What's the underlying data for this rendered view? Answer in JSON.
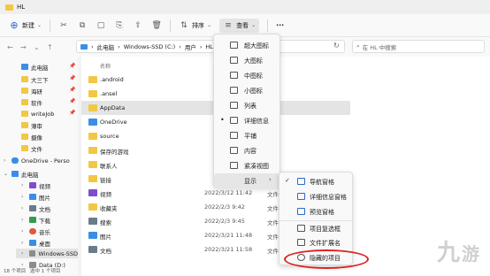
{
  "window": {
    "title": "HL"
  },
  "toolbar": {
    "new_label": "新建",
    "sort_label": "排序",
    "view_label": "查看",
    "more_label": "···"
  },
  "address": {
    "crumbs": [
      "此电脑",
      "Windows-SSD (C:)",
      "用户",
      "HL"
    ],
    "search_placeholder": "在 HL 中搜索"
  },
  "sidebar": {
    "quick": [
      {
        "label": "此电脑",
        "color": "#3a8ee6"
      },
      {
        "label": "大三下",
        "color": "#f2c744"
      },
      {
        "label": "海研",
        "color": "#f2c744"
      },
      {
        "label": "软件",
        "color": "#f2c744"
      },
      {
        "label": "writeJob",
        "color": "#f2c744"
      },
      {
        "label": "薄审",
        "color": "#f2c744"
      },
      {
        "label": "摄像",
        "color": "#f2c744"
      },
      {
        "label": "文件",
        "color": "#f2c744"
      }
    ],
    "onedrive": "OneDrive - Perso",
    "thispc": "此电脑",
    "pc_items": [
      {
        "label": "视频",
        "color": "#7c4dcf"
      },
      {
        "label": "图片",
        "color": "#3a8ee6"
      },
      {
        "label": "文档",
        "color": "#6b7b8c"
      },
      {
        "label": "下载",
        "color": "#2f9d4f"
      },
      {
        "label": "音乐",
        "color": "#e05a3a"
      },
      {
        "label": "桌面",
        "color": "#3a8ee6"
      },
      {
        "label": "Windows-SSD",
        "color": "#8c8c8c"
      },
      {
        "label": "Data (D:)",
        "color": "#8c8c8c"
      }
    ]
  },
  "columns": {
    "name": "名称"
  },
  "files": [
    {
      "name": ".android",
      "date": "",
      "type": "",
      "color": "#f2c744"
    },
    {
      "name": ".ansel",
      "date": "",
      "type": "",
      "color": "#f2c744"
    },
    {
      "name": "AppData",
      "date": "",
      "type": "",
      "color": "#f2c744"
    },
    {
      "name": "OneDrive",
      "date": "",
      "type": "",
      "color": "#3a8ee6"
    },
    {
      "name": "source",
      "date": "",
      "type": "",
      "color": "#f2c744"
    },
    {
      "name": "保存的游戏",
      "date": "",
      "type": "",
      "color": "#f2c744"
    },
    {
      "name": "联系人",
      "date": "",
      "type": "",
      "color": "#f2c744"
    },
    {
      "name": "链接",
      "date": "",
      "type": "",
      "color": "#f2c744"
    },
    {
      "name": "视频",
      "date": "2022/3/12 11:42",
      "type": "文件夹",
      "color": "#7c4dcf"
    },
    {
      "name": "收藏夹",
      "date": "2022/2/3 9:42",
      "type": "文件夹",
      "color": "#f2c744"
    },
    {
      "name": "搜索",
      "date": "2022/2/3 9:45",
      "type": "文件夹",
      "color": "#6b7b8c"
    },
    {
      "name": "图片",
      "date": "2022/3/21 11:48",
      "type": "文件夹",
      "color": "#3a8ee6"
    },
    {
      "name": "文档",
      "date": "2022/3/21 11:58",
      "type": "文件夹",
      "color": "#6b7b8c"
    }
  ],
  "view_menu": [
    {
      "label": "超大图标",
      "dot": ""
    },
    {
      "label": "大图标",
      "dot": ""
    },
    {
      "label": "中图标",
      "dot": ""
    },
    {
      "label": "小图标",
      "dot": ""
    },
    {
      "label": "列表",
      "dot": ""
    },
    {
      "label": "详细信息",
      "dot": "•"
    },
    {
      "label": "平铺",
      "dot": ""
    },
    {
      "label": "内容",
      "dot": ""
    },
    {
      "label": "紧凑视图",
      "dot": ""
    },
    {
      "label": "显示",
      "dot": ""
    }
  ],
  "show_menu": [
    {
      "label": "导航窗格",
      "check": "✓"
    },
    {
      "label": "详细信息窗格",
      "check": ""
    },
    {
      "label": "预览窗格",
      "check": ""
    },
    {
      "label": "项目复选框",
      "check": ""
    },
    {
      "label": "文件扩展名",
      "check": ""
    },
    {
      "label": "隐藏的项目",
      "check": "✓"
    }
  ],
  "status": {
    "count": "18 个项目",
    "selected": "选中 1 个项目"
  },
  "colors": {
    "highlight_circle": "#e02020",
    "accent": "#2c6bc9"
  }
}
